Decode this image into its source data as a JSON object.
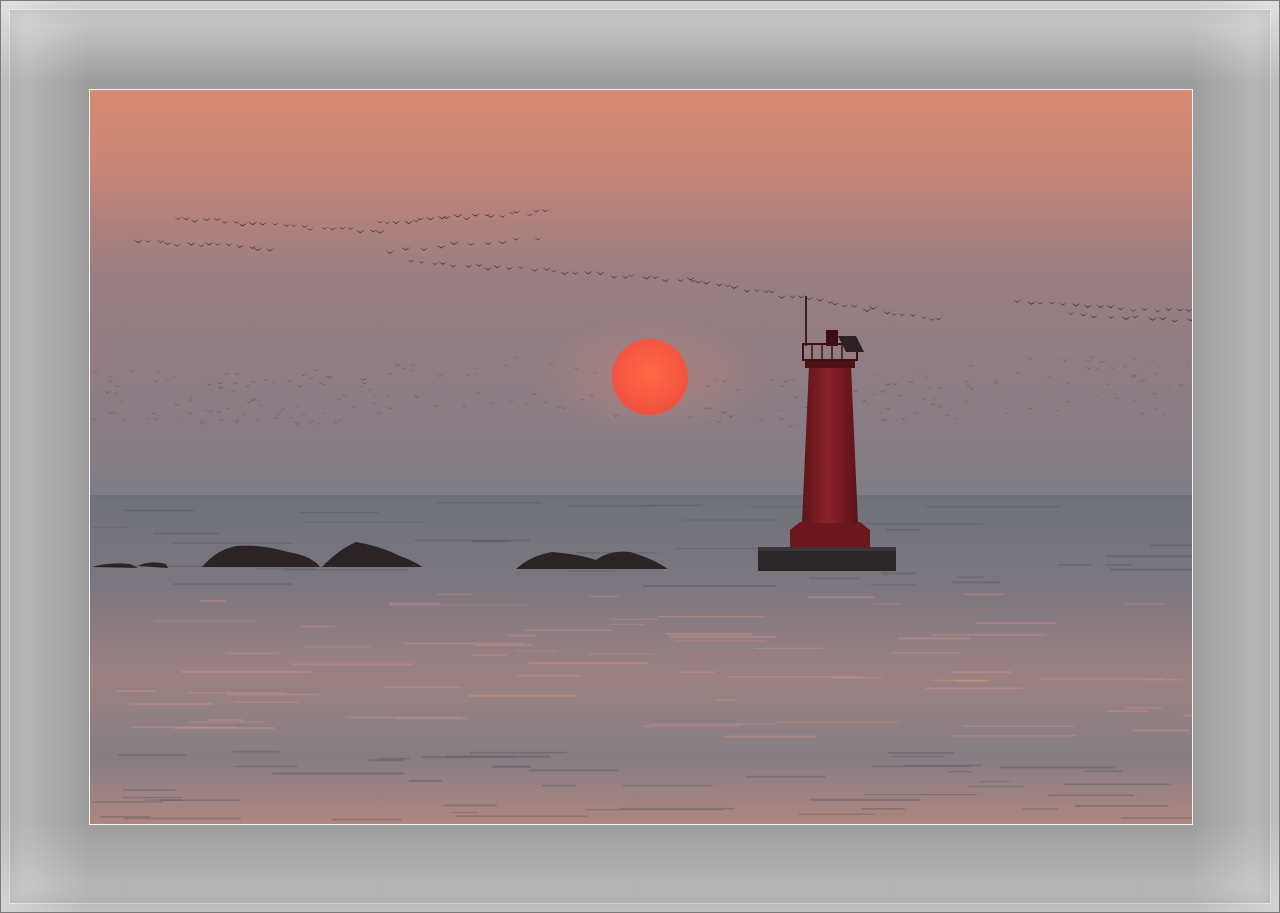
{
  "scene": {
    "subject": "sunset-over-sea-with-lighthouse",
    "colors": {
      "sky_top": "#df8a6d",
      "sky_mid": "#9d7d80",
      "sky_horizon": "#7f7b83",
      "sea": "#7b7b83",
      "sun": "#f25c43",
      "lighthouse": "#7a1b22",
      "silhouette": "#2c2526",
      "frame": "#9c9c9c"
    }
  }
}
